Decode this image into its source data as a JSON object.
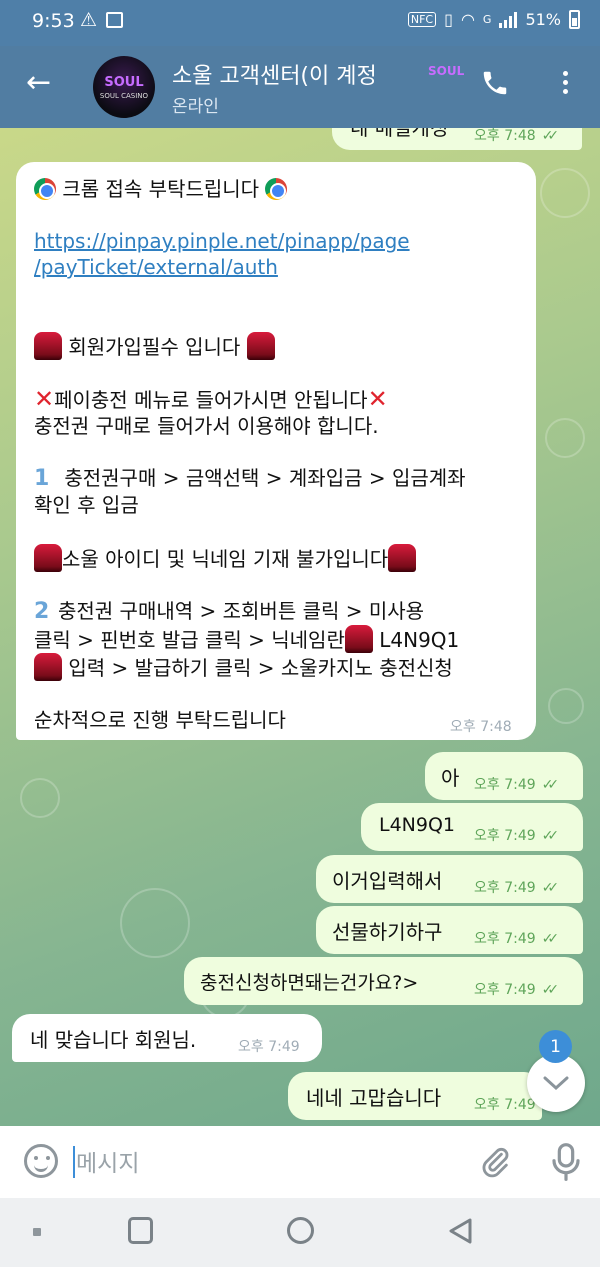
{
  "status_bar": {
    "time": "9:53",
    "battery": "51%",
    "network": "G"
  },
  "header": {
    "title": "소울 고객센터(이 계정",
    "subtitle": "온라인",
    "avatar_logo": "SOUL",
    "avatar_sub": "SOUL CASINO",
    "title_logo": "SOUL"
  },
  "messages": {
    "partial": {
      "text": "네 메일게정",
      "time": "오후 7:48"
    },
    "big": {
      "heading": "크롬 접속 부탁드립니다",
      "link_line1": "https://pinpay.pinple.net/pinapp/page",
      "link_line2": "/payTicket/external/auth",
      "signup": "회원가입필수 입니다",
      "warn1": "페이충전  메뉴로 들어가시면 안됩니다",
      "warn2": "충전권 구매로 들어가서 이용해야 합니다.",
      "step1_num": "1",
      "step1_line1": "충전권구매 > 금액선택 > 계좌입금 > 입금계좌",
      "step1_line2": "확인 후 입금",
      "id_notice": "소울 아이디 및 닉네임 기재 불가입니다",
      "step2_num": "2",
      "step2_line1": "충전권 구매내역 > 조회버튼 클릭 > 미사용",
      "step2_line2a": "클릭 > 핀번호 발급 클릭 > 닉네임란",
      "step2_line2b": "L4N9Q1",
      "step2_line3": "입력 > 발급하기 클릭 > 소울카지노 충전신청",
      "closing": "순차적으로 진행 부탁드립니다",
      "time": "오후 7:48"
    },
    "out1": {
      "text": "아",
      "time": "오후 7:49"
    },
    "out2": {
      "text": "L4N9Q1",
      "time": "오후 7:49"
    },
    "out3": {
      "text": "이거입력해서",
      "time": "오후 7:49"
    },
    "out4": {
      "text": "선물하기하구",
      "time": "오후 7:49"
    },
    "out5": {
      "text": "충전신청하면돼는건가요?>",
      "time": "오후 7:49"
    },
    "in2": {
      "text": "네 맞습니다 회원님.",
      "time": "오후 7:49"
    },
    "out6": {
      "text": "네네 고맙습니다",
      "time": "오후 7:49"
    }
  },
  "unread_badge": "1",
  "composer": {
    "placeholder": "메시지"
  },
  "colors": {
    "header": "#517da2",
    "outgoing_bubble": "#effdde",
    "incoming_bubble": "#ffffff",
    "accent": "#3d8ed8"
  }
}
